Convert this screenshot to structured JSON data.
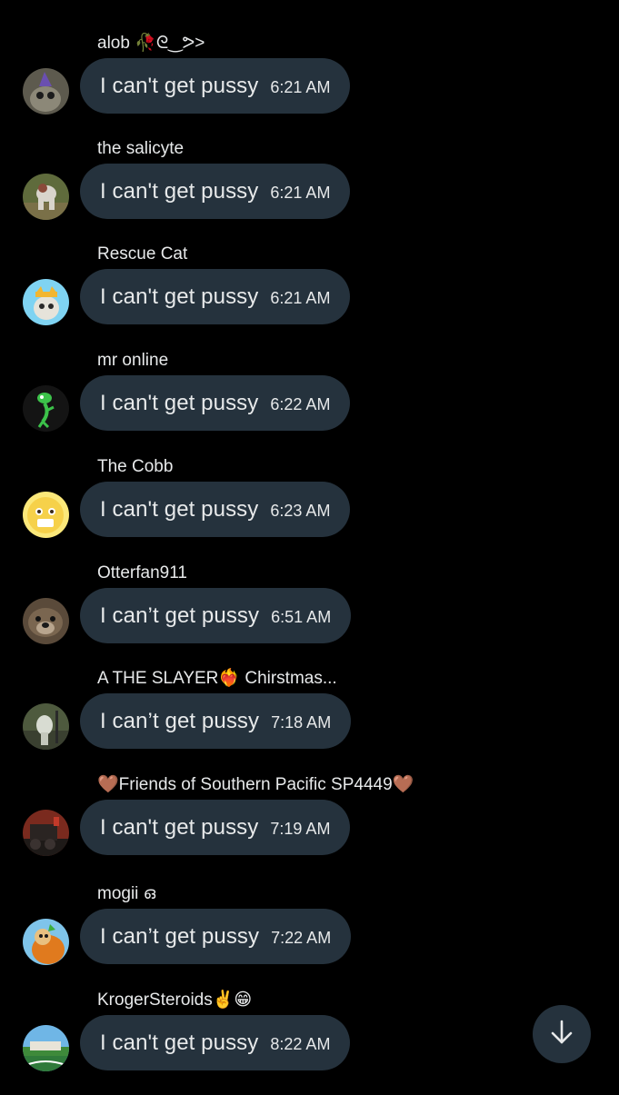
{
  "colors": {
    "background": "#000000",
    "bubble": "#25323d",
    "text": "#e7e9ea"
  },
  "messages": [
    {
      "sender": "alob 🥀ᘓ‿ᕗ>",
      "text": "I can't get pussy",
      "time": "6:21 AM",
      "avatar": "avatar-icon"
    },
    {
      "sender": "the salicyte",
      "text": "I can't get pussy",
      "time": "6:21 AM",
      "avatar": "avatar-icon"
    },
    {
      "sender": "Rescue Cat",
      "text": "I can't get pussy",
      "time": "6:21 AM",
      "avatar": "avatar-icon"
    },
    {
      "sender": "mr online",
      "text": "I can't get pussy",
      "time": "6:22 AM",
      "avatar": "avatar-icon"
    },
    {
      "sender": "The Cobb",
      "text": "I can't get pussy",
      "time": "6:23 AM",
      "avatar": "avatar-icon"
    },
    {
      "sender": "Otterfan911",
      "text": "I can’t get pussy",
      "time": "6:51 AM",
      "avatar": "avatar-icon"
    },
    {
      "sender": "A THE SLAYER❤️‍🔥 Chirstmas...",
      "text": "I can’t get pussy",
      "time": "7:18 AM",
      "avatar": "avatar-icon"
    },
    {
      "sender": "🤎Friends of Southern Pacific SP4449🤎",
      "text": "I can't get pussy",
      "time": "7:19 AM",
      "avatar": "avatar-icon"
    },
    {
      "sender": "mogii ഒ",
      "text": "I can’t get pussy",
      "time": "7:22 AM",
      "avatar": "avatar-icon"
    },
    {
      "sender": "KrogerSteroids✌️😁",
      "text": "I can't get pussy",
      "time": "8:22 AM",
      "avatar": "avatar-icon"
    }
  ],
  "scroll_button": {
    "icon": "arrow-down-icon"
  }
}
